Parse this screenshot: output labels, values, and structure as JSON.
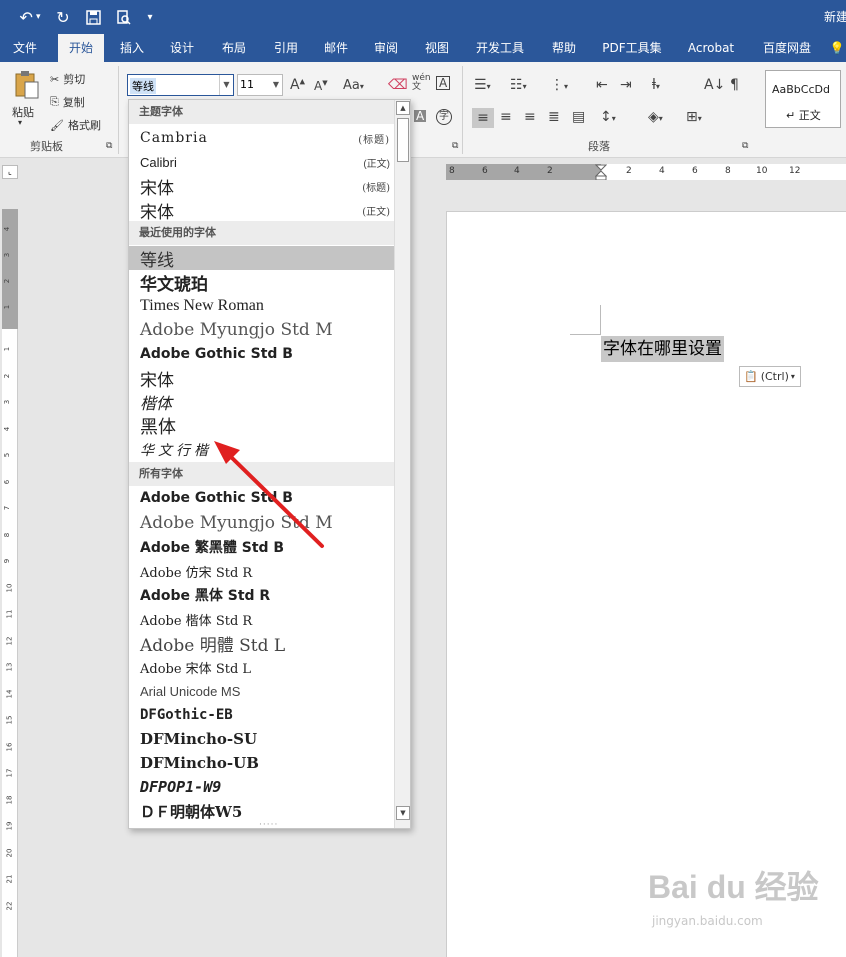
{
  "titlebar": {
    "doc_title": "新建"
  },
  "tabs": [
    "文件",
    "开始",
    "插入",
    "设计",
    "布局",
    "引用",
    "邮件",
    "审阅",
    "视图",
    "开发工具",
    "帮助",
    "PDF工具集",
    "Acrobat",
    "百度网盘"
  ],
  "clipboard": {
    "paste": "粘贴",
    "cut": "剪切",
    "copy": "复制",
    "format_painter": "格式刷",
    "group_label": "剪贴板"
  },
  "font": {
    "current": "等线",
    "size": "11",
    "aa_label": "Aa",
    "wen_label": "wén"
  },
  "paragraph": {
    "group_label": "段落"
  },
  "styles": {
    "sample": "AaBbCcDd",
    "name": "↵ 正文"
  },
  "dropdown": {
    "sections": {
      "theme": "主题字体",
      "recent": "最近使用的字体",
      "all": "所有字体"
    },
    "theme_fonts": [
      {
        "name": "Cambria",
        "tag": "(标题)"
      },
      {
        "name": "Calibri",
        "tag": "(正文)"
      },
      {
        "name": "宋体",
        "tag": "(标题)"
      },
      {
        "name": "宋体",
        "tag": "(正文)"
      }
    ],
    "recent_fonts": [
      "等线",
      "华文琥珀",
      "Times New Roman",
      "Adobe Myungjo Std M",
      "Adobe Gothic Std B",
      "宋体",
      "楷体",
      "黑体",
      "华文行楷"
    ],
    "all_fonts": [
      "Adobe Gothic Std B",
      "Adobe Myungjo Std M",
      "Adobe 繁黑體 Std B",
      "Adobe 仿宋 Std R",
      "Adobe 黑体 Std R",
      "Adobe 楷体 Std R",
      "Adobe 明體 Std L",
      "Adobe 宋体 Std L",
      "Arial Unicode MS",
      "DFGothic-EB",
      "DFMincho-SU",
      "DFMincho-UB",
      "DFPOP1-W9",
      "ＤＦ明朝体W5"
    ]
  },
  "ruler": {
    "h_ticks": [
      "8",
      "6",
      "4",
      "2",
      "2",
      "4",
      "6",
      "8",
      "10",
      "12"
    ],
    "v_ticks": [
      "4",
      "3",
      "2",
      "1",
      "1",
      "2",
      "3",
      "4",
      "5",
      "6",
      "7",
      "8",
      "9",
      "10",
      "11",
      "12",
      "13",
      "14",
      "15",
      "16",
      "17",
      "18",
      "19",
      "20",
      "21",
      "22"
    ]
  },
  "document": {
    "text": "字体在哪里设置",
    "paste_ctrl": "(Ctrl)"
  },
  "watermark": {
    "brand": "Bai du 经验",
    "url": "jingyan.baidu.com"
  },
  "colors": {
    "accent": "#2b579a",
    "annotation_arrow": "#e02020"
  }
}
